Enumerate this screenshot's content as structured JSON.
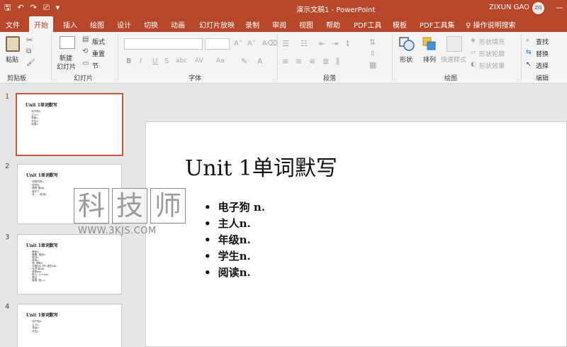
{
  "window": {
    "doc_title": "演示文稿1  -  PowerPoint",
    "user_name": "ZIXUN GAO",
    "avatar_initials": "ZG",
    "accent": "#b7472a"
  },
  "quick_access": {
    "save": "🖫",
    "undo": "↶",
    "redo": "↷",
    "present": "⎚",
    "more": "▾"
  },
  "tabs": [
    {
      "label": "文件"
    },
    {
      "label": "开始"
    },
    {
      "label": "插入"
    },
    {
      "label": "绘图"
    },
    {
      "label": "设计"
    },
    {
      "label": "切换"
    },
    {
      "label": "动画"
    },
    {
      "label": "幻灯片放映"
    },
    {
      "label": "录制"
    },
    {
      "label": "审阅"
    },
    {
      "label": "视图"
    },
    {
      "label": "帮助"
    },
    {
      "label": "PDF工具"
    },
    {
      "label": "模板"
    },
    {
      "label": "PDF工具集"
    }
  ],
  "tell_me": "操作说明搜索",
  "ribbon": {
    "clipboard": {
      "paste": "粘贴",
      "label": "剪贴板"
    },
    "slides": {
      "new_slide": "新建\n幻灯片",
      "new_slide_1": "新建",
      "new_slide_2": "幻灯片",
      "layout": "版式",
      "reset": "重置",
      "section": "节",
      "label": "幻灯片"
    },
    "font": {
      "label": "字体",
      "bold": "B",
      "italic": "I",
      "underline": "U",
      "strike": "S",
      "abc": "abc",
      "av": "AV",
      "aa": "Aa"
    },
    "paragraph": {
      "label": "段落"
    },
    "drawing": {
      "shape": "形状",
      "arrange": "排列",
      "quick_style": "快速样式",
      "fill": "形状填充",
      "outline": "形状轮廓",
      "effect": "形状效果",
      "label": "绘图"
    },
    "editing": {
      "find": "查找",
      "replace": "替换",
      "select": "选择",
      "label": "编辑"
    }
  },
  "thumbnails": [
    {
      "num": "1",
      "title": "Unit 1单词默写",
      "lines": [
        "· 电子狗n.",
        "· 主人n.",
        "· 年级n.",
        "· 学生n.",
        "· 阅读n."
      ]
    },
    {
      "num": "2",
      "title": "Unit 1单词默写",
      "lines": [
        "· 四班同学n.",
        "· 放学后",
        "· 照顾 做adj.",
        "· 爬不了",
        "· 在……(形状)"
      ]
    },
    {
      "num": "3",
      "title": "Unit 1单词默写",
      "lines": [
        "· 教室n.",
        "· 酶素, 描述n.",
        "· 图书n.",
        "· 体育n.",
        "· 帮, 帮助n.",
        "· 可爱adj. 好人类形adj.",
        "· 在学 那adj.",
        "· 医院adj.",
        "· 助人, 人人adv.",
        "· 看过",
        "· 聚报 (常) n."
      ]
    },
    {
      "num": "4",
      "title": "Unit 1单词默写",
      "lines": [
        "· 电子狗n.",
        "· 主人n.",
        "· 年级n.",
        "· 学生n."
      ]
    }
  ],
  "slide": {
    "title": "Unit 1单词默写",
    "bullets": [
      "电子狗 n.",
      "主人n.",
      "年级n.",
      "学生n.",
      "阅读n."
    ]
  },
  "watermark": {
    "chars": [
      "科",
      "技",
      "师"
    ],
    "url": "WWW.3KJS.COM"
  }
}
